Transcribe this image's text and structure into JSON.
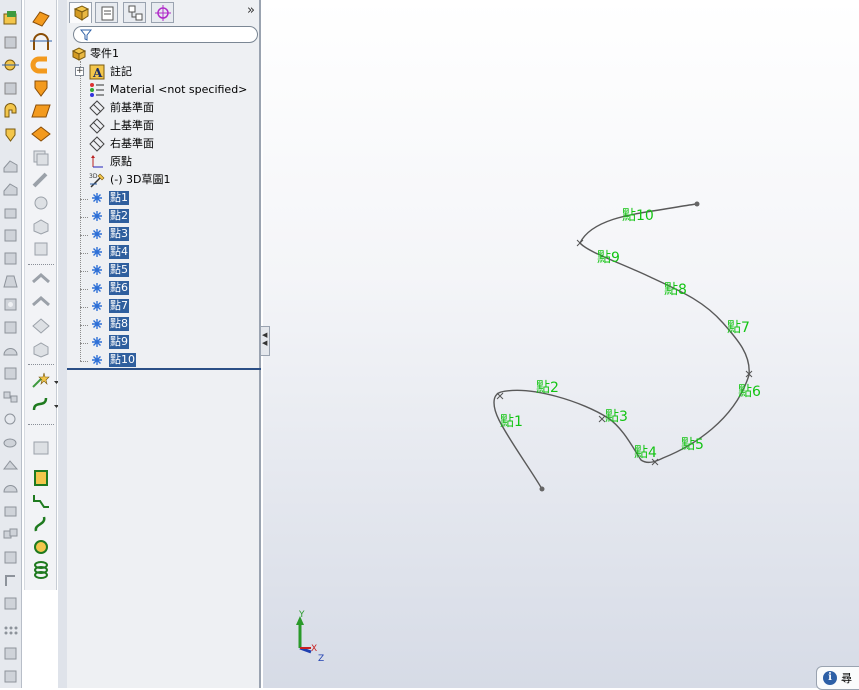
{
  "feature_manager": {
    "tabs": [
      {
        "name": "featuremanager-tab",
        "icon": "feature-tree-icon"
      },
      {
        "name": "propertymanager-tab",
        "icon": "property-sheet-icon"
      },
      {
        "name": "configurationmanager-tab",
        "icon": "configuration-icon"
      },
      {
        "name": "dimxpert-tab",
        "icon": "crosshair-target-icon"
      }
    ],
    "collapse_chevron": "»",
    "root": "零件1",
    "items": [
      {
        "label": "註記",
        "icon": "annotation-icon",
        "expandable": true
      },
      {
        "label": "Material <not specified>",
        "icon": "material-icon"
      },
      {
        "label": "前基準面",
        "icon": "plane-icon"
      },
      {
        "label": "上基準面",
        "icon": "plane-icon"
      },
      {
        "label": "右基準面",
        "icon": "plane-icon"
      },
      {
        "label": "原點",
        "icon": "origin-icon"
      },
      {
        "label": "(-) 3D草圖1",
        "icon": "3d-sketch-icon"
      }
    ],
    "points": [
      {
        "label": "點1"
      },
      {
        "label": "點2"
      },
      {
        "label": "點3"
      },
      {
        "label": "點4"
      },
      {
        "label": "點5"
      },
      {
        "label": "點6"
      },
      {
        "label": "點7"
      },
      {
        "label": "點8"
      },
      {
        "label": "點9"
      },
      {
        "label": "點10"
      }
    ],
    "accent_color": "#2f5f9e",
    "rollback_color": "#2b4f86"
  },
  "viewport": {
    "curve_color": "#555555",
    "label_color": "#14c414",
    "point_labels": [
      "點1",
      "點2",
      "點3",
      "點4",
      "點5",
      "點6",
      "點7",
      "點8",
      "點9",
      "點10"
    ],
    "triad": {
      "x": "X",
      "y": "Y",
      "z": "Z"
    }
  },
  "status": {
    "info_icon": "i",
    "info_text": "尋"
  }
}
